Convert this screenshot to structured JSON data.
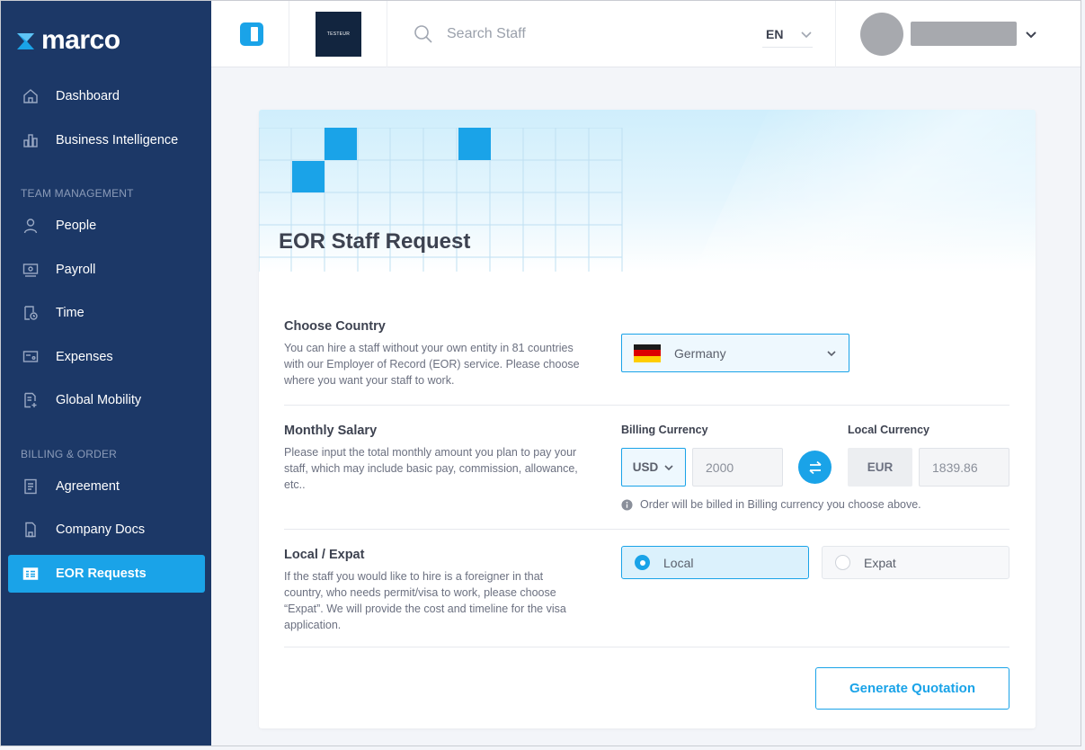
{
  "app": {
    "name": "marco"
  },
  "sidebar": {
    "items": [
      {
        "label": "Dashboard",
        "icon": "home-icon"
      },
      {
        "label": "Business Intelligence",
        "icon": "bar-chart-icon"
      },
      {
        "label": "People",
        "icon": "person-icon"
      },
      {
        "label": "Payroll",
        "icon": "payroll-icon"
      },
      {
        "label": "Time",
        "icon": "time-icon"
      },
      {
        "label": "Expenses",
        "icon": "expenses-icon"
      },
      {
        "label": "Global Mobility",
        "icon": "global-mobility-icon"
      },
      {
        "label": "Agreement",
        "icon": "agreement-icon"
      },
      {
        "label": "Company Docs",
        "icon": "company-docs-icon"
      },
      {
        "label": "EOR Requests",
        "icon": "eor-requests-icon",
        "active": true
      }
    ],
    "sections": {
      "team": "TEAM MANAGEMENT",
      "billing": "BILLING & ORDER"
    }
  },
  "topbar": {
    "company_logo_text": "TESTEUR",
    "search_placeholder": "Search Staff",
    "language": "EN"
  },
  "page": {
    "title": "EOR Staff Request",
    "country": {
      "title": "Choose Country",
      "description": "You can hire a staff without your own entity in 81 countries with our Employer of Record (EOR) service. Please choose where you want your staff to work.",
      "selected": "Germany"
    },
    "salary": {
      "title": "Monthly Salary",
      "description": "Please input the total monthly amount you plan to pay your staff, which may include basic pay, commission, allowance, etc..",
      "billing_label": "Billing Currency",
      "local_label": "Local Currency",
      "billing_currency": "USD",
      "billing_amount": "2000",
      "local_currency": "EUR",
      "local_amount": "1839.86",
      "info": "Order will be billed in Billing currency you choose above."
    },
    "local_expat": {
      "title": "Local / Expat",
      "description": "If the staff you would like to hire is a foreigner in that country, who needs permit/visa to work, please choose “Expat”. We will provide the cost and timeline for the visa application.",
      "options": [
        "Local",
        "Expat"
      ],
      "selected": "Local"
    },
    "generate_button": "Generate Quotation"
  },
  "colors": {
    "sidebar_bg": "#1c3867",
    "accent": "#1aa3e8",
    "page_bg": "#f3f5f9"
  }
}
